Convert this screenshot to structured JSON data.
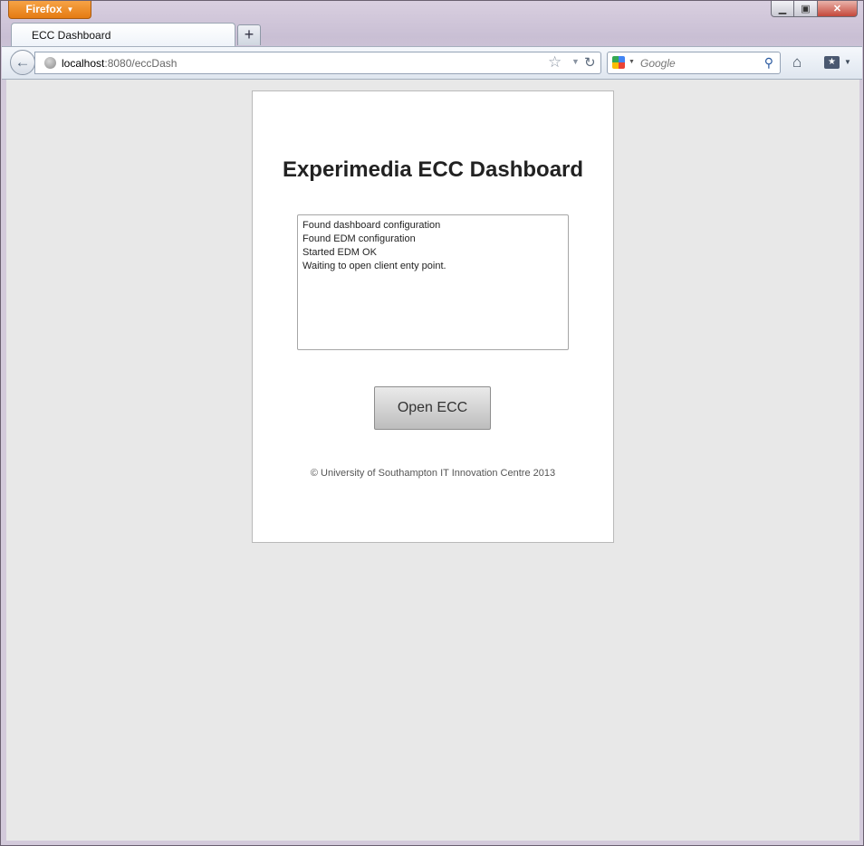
{
  "browser": {
    "app_button_label": "Firefox",
    "tab_title": "ECC Dashboard",
    "url_host": "localhost",
    "url_rest": ":8080/eccDash",
    "search_placeholder": "Google"
  },
  "icons": {
    "back": "back-arrow-icon",
    "site": "globe-icon",
    "bookmark": "star-icon",
    "reload": "reload-icon",
    "search_engine": "google-icon",
    "search": "magnifier-icon",
    "home": "home-icon",
    "bookmarks_menu": "bookmarks-icon"
  },
  "page": {
    "title": "Experimedia ECC Dashboard",
    "log_lines": [
      "Found dashboard configuration",
      "Found EDM configuration",
      "Started EDM OK",
      "Waiting to open client enty point."
    ],
    "open_button_label": "Open ECC",
    "footer": "© University of Southampton IT Innovation Centre 2013"
  }
}
